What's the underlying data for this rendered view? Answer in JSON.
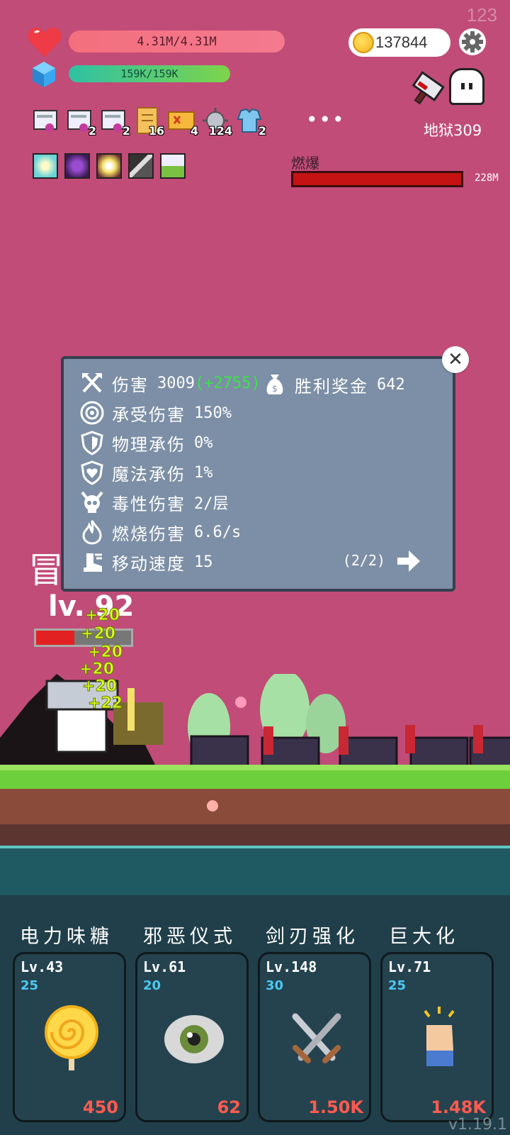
{
  "fps": "123",
  "hud": {
    "hp_text": "4.31M/4.31M",
    "mp_text": "159K/159K",
    "coins": "137844",
    "stage": "地狱309",
    "more": "•••"
  },
  "items": [
    {
      "name": "scroll-purple-icon",
      "count": ""
    },
    {
      "name": "scroll-purple-icon",
      "count": "2"
    },
    {
      "name": "scroll-purple-icon",
      "count": "2"
    },
    {
      "name": "map-scroll-icon",
      "count": "16"
    },
    {
      "name": "ticket-icon",
      "count": "4"
    },
    {
      "name": "spiked-ball-icon",
      "count": "124"
    },
    {
      "name": "armor-icon",
      "count": "2"
    }
  ],
  "boss": {
    "name": "燃爆",
    "hp": "228M",
    "hp_fraction": 1.0
  },
  "hero": {
    "name": "冒",
    "level": "lv. 92",
    "hp_fraction": 0.4
  },
  "dialog": {
    "reward_label": "胜利奖金",
    "reward_value": "642",
    "rows": [
      {
        "label": "伤害",
        "value": "3009",
        "bonus": "(+2755)"
      },
      {
        "label": "承受伤害",
        "value": "150%"
      },
      {
        "label": "物理承伤",
        "value": "0%"
      },
      {
        "label": "魔法承伤",
        "value": "1%"
      },
      {
        "label": "毒性伤害",
        "value": "2/层"
      },
      {
        "label": "燃烧伤害",
        "value": "6.6/s"
      },
      {
        "label": "移动速度",
        "value": "15"
      }
    ],
    "page": "(2/2)",
    "close": "✕"
  },
  "skills": [
    {
      "title": "电力味糖",
      "level": "Lv.43",
      "sub": "25",
      "cost": "450",
      "icon": "lollipop-icon"
    },
    {
      "title": "邪恶仪式",
      "level": "Lv.61",
      "sub": "20",
      "cost": "62",
      "icon": "eye-icon"
    },
    {
      "title": "剑刃强化",
      "level": "Lv.148",
      "sub": "30",
      "cost": "1.50K",
      "icon": "crossed-swords-icon"
    },
    {
      "title": "巨大化",
      "level": "Lv.71",
      "sub": "25",
      "cost": "1.48K",
      "icon": "fist-icon"
    }
  ],
  "version": "v1.19.1",
  "colors": {
    "background": "#c14c78",
    "panel": "#7c8fa6",
    "bottom": "#203f4a",
    "cost": "#ff5a4f",
    "sub": "#4cc8f2"
  }
}
